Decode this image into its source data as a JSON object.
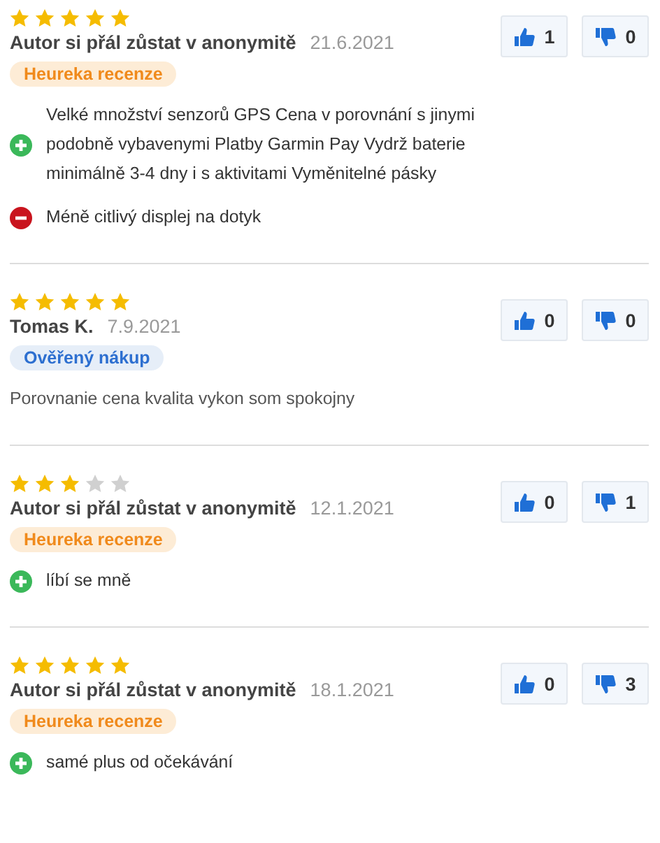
{
  "reviews": [
    {
      "stars": 5,
      "author": "Autor si přál zůstat v anonymitě",
      "date": "21.6.2021",
      "badge": {
        "kind": "heureka",
        "label": "Heureka recenze"
      },
      "likes": "1",
      "dislikes": "0",
      "points": [
        {
          "kind": "pro",
          "text": "Velké množství senzorů GPS Cena v porovnání s jinymi podobně vybavenymi Platby Garmin Pay Vydrž baterie minimálně 3-4 dny i s aktivitami Vyměnitelné pásky"
        },
        {
          "kind": "con",
          "text": "Méně citlivý displej na dotyk"
        }
      ]
    },
    {
      "stars": 5,
      "author": "Tomas K.",
      "date": "7.9.2021",
      "badge": {
        "kind": "verified",
        "label": "Ověřený nákup"
      },
      "likes": "0",
      "dislikes": "0",
      "points": [
        {
          "kind": "text",
          "text": "Porovnanie cena kvalita vykon som spokojny"
        }
      ]
    },
    {
      "stars": 3,
      "author": "Autor si přál zůstat v anonymitě",
      "date": "12.1.2021",
      "badge": {
        "kind": "heureka",
        "label": "Heureka recenze"
      },
      "likes": "0",
      "dislikes": "1",
      "points": [
        {
          "kind": "pro",
          "text": "líbí se mně"
        }
      ]
    },
    {
      "stars": 5,
      "author": "Autor si přál zůstat v anonymitě",
      "date": "18.1.2021",
      "badge": {
        "kind": "heureka",
        "label": "Heureka recenze"
      },
      "likes": "0",
      "dislikes": "3",
      "points": [
        {
          "kind": "pro",
          "text": "samé plus od očekávání"
        }
      ]
    }
  ]
}
